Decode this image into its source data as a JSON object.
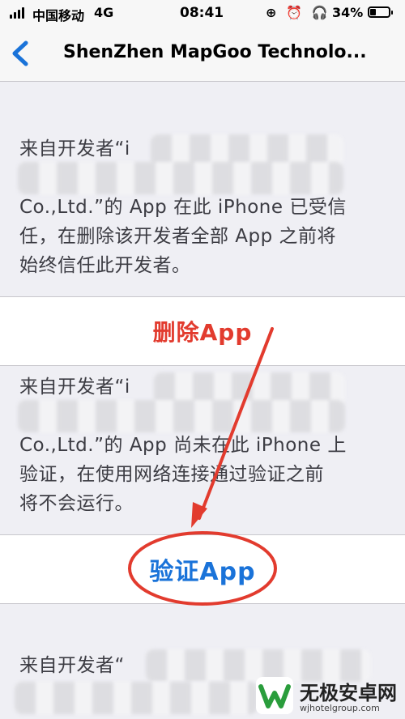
{
  "status_bar": {
    "carrier": "中国移动",
    "network": "4G",
    "time": "08:41",
    "icons": "⊕ ⏰ 🎧",
    "battery_percent": "34%",
    "battery_level": 0.34
  },
  "nav": {
    "title": "ShenZhen MapGoo Technolo..."
  },
  "block1": {
    "lines": [
      "来自开发者“i",
      "",
      "Co.,Ltd.”的 App 在此 iPhone 已受信",
      "任，在删除该开发者全部 App 之前将",
      "始终信任此开发者。"
    ]
  },
  "delete_button": {
    "label": "删除App"
  },
  "block2": {
    "lines": [
      "来自开发者“i",
      "",
      "Co.,Ltd.”的 App 尚未在此 iPhone 上",
      "验证，在使用网络连接通过验证之前",
      "将不会运行。"
    ]
  },
  "verify_button": {
    "label": "验证App"
  },
  "block3": {
    "lines": [
      "来自开发者“"
    ]
  },
  "watermark": {
    "name": "无极安卓网",
    "url": "wjhotelgroup.com"
  },
  "colors": {
    "accent_blue": "#1a73d9",
    "annotation_red": "#e23b2e",
    "background": "#efeff4"
  }
}
